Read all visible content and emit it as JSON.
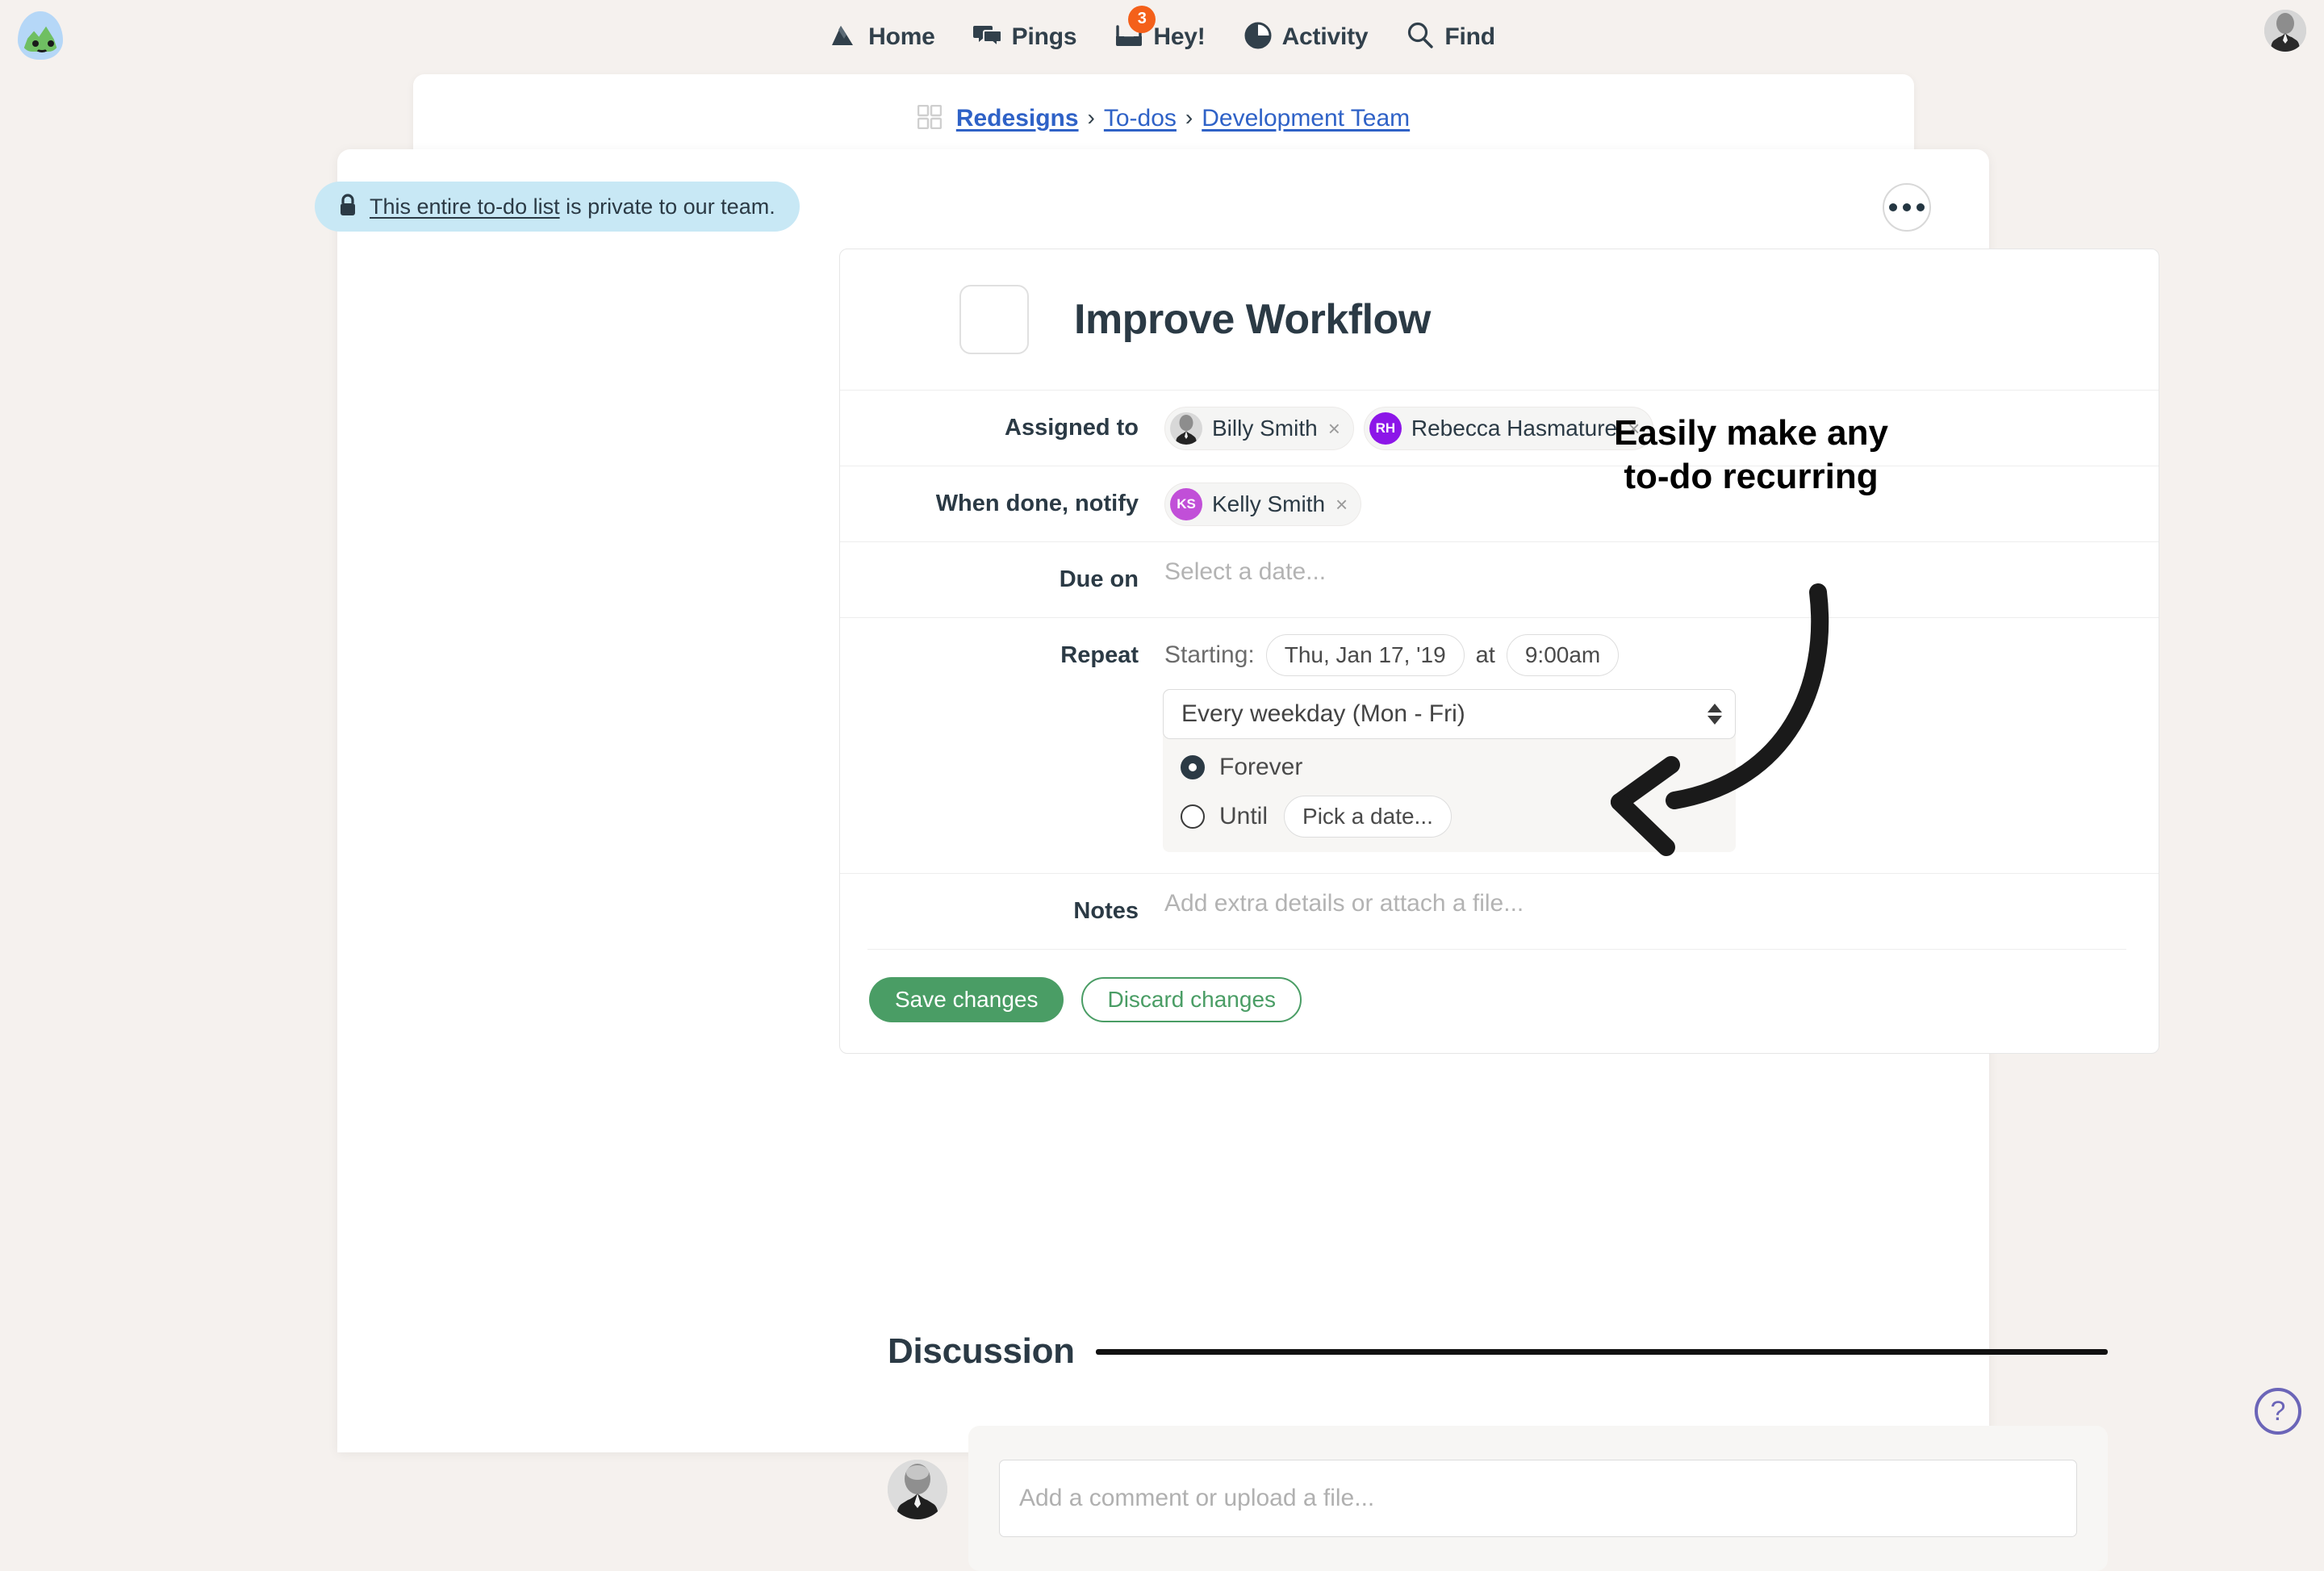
{
  "brand": {
    "logo_name": "basecamp-logo"
  },
  "topnav": {
    "items": [
      {
        "label": "Home",
        "icon": "home-icon"
      },
      {
        "label": "Pings",
        "icon": "pings-icon"
      },
      {
        "label": "Hey!",
        "icon": "hey-inbox-icon",
        "badge": "3"
      },
      {
        "label": "Activity",
        "icon": "activity-pie-icon"
      },
      {
        "label": "Find",
        "icon": "search-icon"
      }
    ],
    "avatar_name": "user-avatar"
  },
  "breadcrumb": {
    "grid_icon": "grid-icon",
    "items": [
      {
        "label": "Redesigns",
        "bold": true
      },
      {
        "label": "To-dos",
        "bold": false
      },
      {
        "label": "Development Team",
        "bold": false
      }
    ],
    "separator": "›"
  },
  "privacy_notice": {
    "lock_icon": "lock-icon",
    "link_text": "This entire to-do list",
    "rest_text": " is private to our team.",
    "background": "#c8e8f5"
  },
  "more_menu": {
    "label": "…"
  },
  "todo": {
    "title": "Improve Workflow",
    "checkbox_checked": false,
    "fields": {
      "assigned_to": {
        "label": "Assigned to",
        "people": [
          {
            "name": "Billy Smith",
            "initials": "",
            "avatar_type": "photo",
            "color": "#9b9b9b",
            "remove": "×"
          },
          {
            "name": "Rebecca Hasmature",
            "initials": "RH",
            "avatar_type": "initials",
            "color": "#8c16e8",
            "remove": "×"
          }
        ]
      },
      "notify_when_done": {
        "label": "When done, notify",
        "people": [
          {
            "name": "Kelly Smith",
            "initials": "KS",
            "avatar_type": "initials",
            "color": "#c14fd8",
            "remove": "×"
          }
        ]
      },
      "due_on": {
        "label": "Due on",
        "placeholder": "Select a date..."
      },
      "repeat": {
        "label": "Repeat",
        "starting_label": "Starting:",
        "start_date": "Thu, Jan 17, '19",
        "at_label": "at",
        "start_time": "9:00am",
        "frequency": "Every weekday (Mon - Fri)",
        "end_options": [
          {
            "label": "Forever",
            "selected": true
          },
          {
            "label": "Until",
            "selected": false,
            "date_placeholder": "Pick a date..."
          }
        ]
      },
      "notes": {
        "label": "Notes",
        "placeholder": "Add extra details or attach a file..."
      }
    },
    "save_label": "Save changes",
    "discard_label": "Discard changes",
    "save_color": "#4a9d65"
  },
  "annotation": {
    "line1": "Easily make any",
    "line2": "to-do recurring",
    "arrow": "curved-left-arrow"
  },
  "discussion": {
    "title": "Discussion",
    "comment_placeholder": "Add a comment or upload a file...",
    "avatar_name": "commenter-avatar"
  },
  "help": {
    "label": "?",
    "color": "#6b65b8"
  }
}
